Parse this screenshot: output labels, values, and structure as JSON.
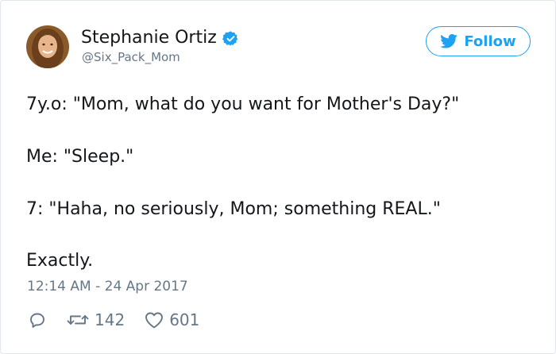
{
  "user": {
    "name": "Stephanie Ortiz",
    "handle": "@Six_Pack_Mom",
    "verified": true
  },
  "follow_button": {
    "label": "Follow"
  },
  "tweet": {
    "lines": [
      "7y.o: \"Mom, what do you want for Mother's Day?\"",
      "Me: \"Sleep.\"",
      "7: \"Haha, no seriously, Mom; something REAL.\"",
      "Exactly."
    ],
    "timestamp": "12:14 AM - 24 Apr 2017"
  },
  "actions": {
    "retweets": "142",
    "likes": "601"
  },
  "colors": {
    "accent": "#1da1f2",
    "text": "#14171a",
    "muted": "#657786"
  }
}
